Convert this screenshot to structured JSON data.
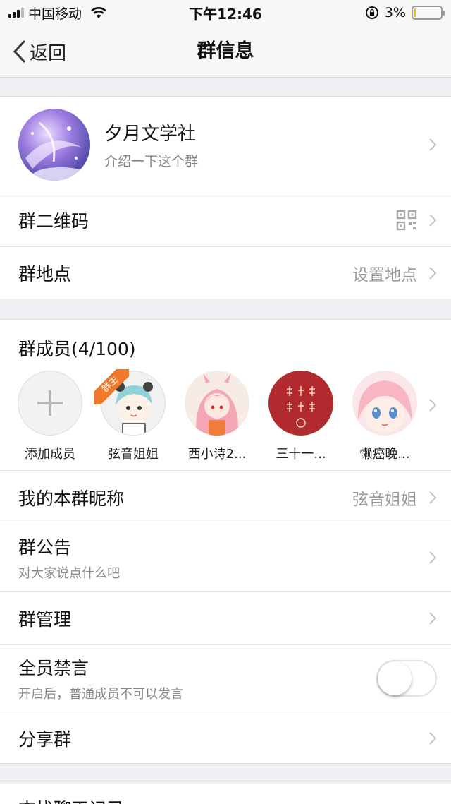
{
  "status": {
    "carrier": "中国移动",
    "time": "下午12:46",
    "battery": "3%",
    "battery_level": 0.03
  },
  "nav": {
    "back": "返回",
    "title": "群信息"
  },
  "group": {
    "name": "夕月文学社",
    "intro": "介绍一下这个群"
  },
  "rows": {
    "qr": "群二维码",
    "location": "群地点",
    "location_value": "设置地点",
    "nickname": "我的本群昵称",
    "nickname_value": "弦音姐姐",
    "notice": "群公告",
    "notice_sub": "对大家说点什么吧",
    "manage": "群管理",
    "mute": "全员禁言",
    "mute_sub": "开启后，普通成员不可以发言",
    "mute_on": false,
    "share": "分享群",
    "search": "查找聊天记录"
  },
  "members": {
    "title": "群成员(4/100)",
    "owner_badge": "群主",
    "add_label": "添加成员",
    "list": [
      {
        "name": "弦音姐姐"
      },
      {
        "name": "西小诗2..."
      },
      {
        "name": "三十一..."
      },
      {
        "name": "懒癌晚..."
      }
    ]
  },
  "colors": {
    "background": "#efeff4",
    "owner_badge": "#f0782a",
    "seal_red": "#b02a2e"
  }
}
